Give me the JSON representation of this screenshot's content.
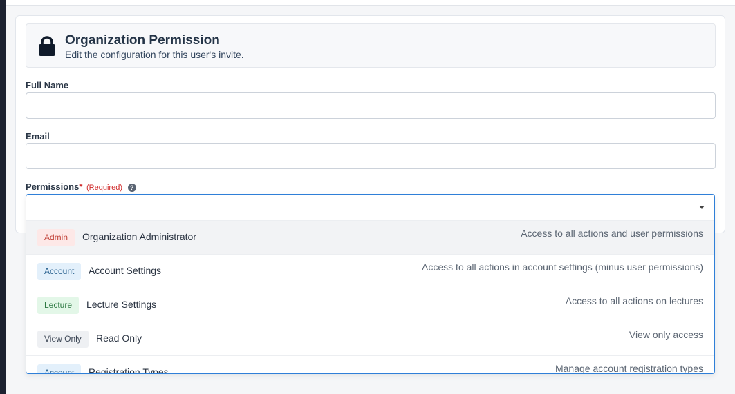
{
  "header": {
    "title": "Organization Permission",
    "subtitle": "Edit the configuration for this user's invite.",
    "icon": "lock-icon"
  },
  "fields": {
    "full_name": {
      "label": "Full Name",
      "value": "",
      "placeholder": ""
    },
    "email": {
      "label": "Email",
      "value": "",
      "placeholder": ""
    },
    "permissions": {
      "label": "Permissions",
      "required_mark": "*",
      "required_note": "(Required)",
      "help_icon": "question-circle-icon",
      "help_glyph": "?",
      "selected": ""
    }
  },
  "options": [
    {
      "badge": "Admin",
      "name": "Organization Administrator",
      "description": "Access to all actions and user permissions",
      "badge_bg": "#fde8e7",
      "badge_fg": "#c2433a",
      "active": true
    },
    {
      "badge": "Account",
      "name": "Account Settings",
      "description": "Access to all actions in account settings (minus user permissions)",
      "badge_bg": "#e3f0fb",
      "badge_fg": "#28618f",
      "active": false
    },
    {
      "badge": "Lecture",
      "name": "Lecture Settings",
      "description": "Access to all actions on lectures",
      "badge_bg": "#e3f7e8",
      "badge_fg": "#2f7a44",
      "active": false
    },
    {
      "badge": "View Only",
      "name": "Read Only",
      "description": "View only access",
      "badge_bg": "#eef0f3",
      "badge_fg": "#3b4554",
      "active": false
    },
    {
      "badge": "Account",
      "name": "Registration Types",
      "description": "Manage account registration types",
      "badge_bg": "#e3f0fb",
      "badge_fg": "#28618f",
      "active": false
    }
  ],
  "colors": {
    "accent_border": "#2f7fd8",
    "required": "#d02b2b",
    "sidebar": "#1c2130"
  }
}
